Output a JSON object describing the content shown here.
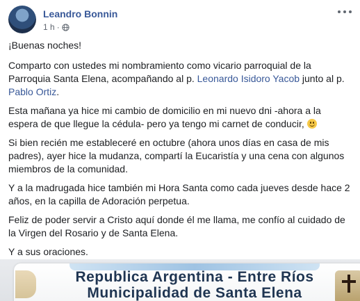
{
  "post": {
    "author": "Leandro Bonnin",
    "time": "1 h",
    "separator": "·",
    "paragraphs": {
      "p1": "¡Buenas noches!",
      "p2a": "Comparto con ustedes mi nombramiento como vicario parroquial de la Parroquia Santa Elena, acompañando al p. ",
      "p2_link1": "Leonardo Isidoro Yacob",
      "p2b": " junto al p. ",
      "p2_link2": "Pablo Ortiz",
      "p2c": ".",
      "p3": "Esta mañana ya hice mi cambio de domicilio en mi nuevo dni -ahora a la espera de que llegue la cédula- pero ya tengo mi carnet de conducir, ",
      "p4": "Si bien recién me estableceré en octubre (ahora unos días en casa de mis padres), ayer hice la mudanza, compartí la Eucaristía y una cena con algunos miembros de la comunidad.",
      "p5": "Y a la madrugada hice también mi Hora Santa como cada jueves desde hace 2 años, en la capilla de Adoración perpetua.",
      "p6": "Feliz de poder servir a Cristo aquí donde él me llama, me confío al cuidado de la Virgen del Rosario y de Santa Elena.",
      "p7": "Y a sus oraciones."
    },
    "attachment": {
      "line1": "Republica Argentina - Entre Ríos",
      "line2": "Municipalidad de Santa Elena"
    }
  },
  "colors": {
    "link": "#385898",
    "text": "#1c1e21",
    "meta": "#606770"
  },
  "icons": [
    "globe-icon",
    "more-options-icon",
    "smiley-emoji"
  ]
}
